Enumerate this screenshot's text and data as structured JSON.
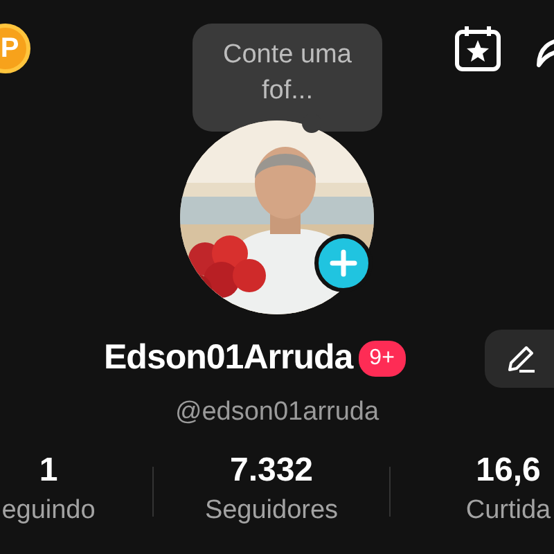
{
  "header": {
    "coin_label": "P",
    "status_bubble": "Conte uma fof..."
  },
  "profile": {
    "display_name": "Edson01Arruda",
    "notification_badge": "9+",
    "handle": "@edson01arruda"
  },
  "stats": [
    {
      "value": "1",
      "label": "eguindo"
    },
    {
      "value": "7.332",
      "label": "Seguidores"
    },
    {
      "value": "16,6",
      "label": "Curtida"
    }
  ]
}
